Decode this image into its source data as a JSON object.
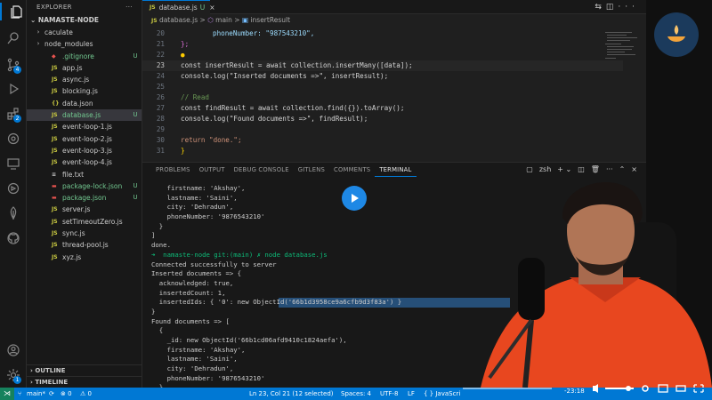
{
  "sidebar": {
    "title": "EXPLORER",
    "folder": "NAMASTE-NODE",
    "items": [
      {
        "label": "caculate",
        "type": "folder",
        "status": "",
        "icon": "chevron-right"
      },
      {
        "label": "node_modules",
        "type": "folder",
        "status": "",
        "icon": "chevron-right"
      },
      {
        "label": ".gitignore",
        "type": "git",
        "status": "U",
        "icon": "git-icon"
      },
      {
        "label": "app.js",
        "type": "js",
        "status": "",
        "icon": "JS"
      },
      {
        "label": "async.js",
        "type": "js",
        "status": "",
        "icon": "JS"
      },
      {
        "label": "blocking.js",
        "type": "js",
        "status": "",
        "icon": "JS"
      },
      {
        "label": "data.json",
        "type": "json",
        "status": "",
        "icon": "{}"
      },
      {
        "label": "database.js",
        "type": "js",
        "status": "U",
        "icon": "JS",
        "selected": true
      },
      {
        "label": "event-loop-1.js",
        "type": "js",
        "status": "",
        "icon": "JS"
      },
      {
        "label": "event-loop-2.js",
        "type": "js",
        "status": "",
        "icon": "JS"
      },
      {
        "label": "event-loop-3.js",
        "type": "js",
        "status": "",
        "icon": "JS"
      },
      {
        "label": "event-loop-4.js",
        "type": "js",
        "status": "",
        "icon": "JS"
      },
      {
        "label": "file.txt",
        "type": "txt",
        "status": "",
        "icon": "≡"
      },
      {
        "label": "package-lock.json",
        "type": "npm",
        "status": "U",
        "icon": "npm"
      },
      {
        "label": "package.json",
        "type": "npm",
        "status": "U",
        "icon": "npm"
      },
      {
        "label": "server.js",
        "type": "js",
        "status": "",
        "icon": "JS"
      },
      {
        "label": "setTimeoutZero.js",
        "type": "js",
        "status": "",
        "icon": "JS"
      },
      {
        "label": "sync.js",
        "type": "js",
        "status": "",
        "icon": "JS"
      },
      {
        "label": "thread-pool.js",
        "type": "js",
        "status": "",
        "icon": "JS"
      },
      {
        "label": "xyz.js",
        "type": "js",
        "status": "",
        "icon": "JS"
      }
    ],
    "outline": "OUTLINE",
    "timeline": "TIMELINE"
  },
  "tab": {
    "icon": "JS",
    "label": "database.js",
    "status": "U"
  },
  "breadcrumb": {
    "icon": "JS",
    "file": "database.js",
    "sep": ">",
    "fn": "main",
    "var": "insertResult"
  },
  "code": [
    {
      "n": "20",
      "text": "phoneNumber: \"987543210\","
    },
    {
      "n": "21",
      "text": "};"
    },
    {
      "n": "22",
      "text": ""
    },
    {
      "n": "23",
      "text": "const insertResult = await collection.insertMany([data]);"
    },
    {
      "n": "24",
      "text": "console.log(\"Inserted documents =>\", insertResult);"
    },
    {
      "n": "25",
      "text": ""
    },
    {
      "n": "26",
      "text": "// Read"
    },
    {
      "n": "27",
      "text": "const findResult = await collection.find({}).toArray();"
    },
    {
      "n": "28",
      "text": "console.log(\"Found documents =>\", findResult);"
    },
    {
      "n": "29",
      "text": ""
    },
    {
      "n": "30",
      "text": "return \"done.\";"
    },
    {
      "n": "31",
      "text": "}"
    }
  ],
  "panel": {
    "tabs": [
      "PROBLEMS",
      "OUTPUT",
      "DEBUG CONSOLE",
      "GITLENS",
      "COMMENTS",
      "TERMINAL"
    ],
    "active_tab": "TERMINAL",
    "shell": "zsh"
  },
  "terminal": [
    "    firstname: 'Akshay',",
    "    lastname: 'Saini',",
    "    city: 'Dehradun',",
    "    phoneNumber: '9876543210'",
    "  }",
    "]",
    "done.",
    "➜  namaste-node git:(main) ✗ node database.js",
    "Connected successfully to server",
    "Inserted documents => {",
    "  acknowledged: true,",
    "  insertedCount: 1,",
    "  insertedIds: { '0': new ObjectId('66b1d3958ce9a6cfb9d3f83a') }",
    "}",
    "Found documents => [",
    "  {",
    "    _id: new ObjectId('66b1cd06afd9410c1824aefa'),",
    "    firstname: 'Akshay',",
    "    lastname: 'Saini',",
    "    city: 'Dehradun',",
    "    phoneNumber: '9876543210'",
    "  },",
    "  {"
  ],
  "status": {
    "branch": "main*",
    "errors": "⊗ 0",
    "warnings": "⚠ 0",
    "position": "Ln 23, Col 21 (12 selected)",
    "spaces": "Spaces: 4",
    "encoding": "UTF-8",
    "eol": "LF",
    "language": "{ } JavaScri",
    "time": "-23:18"
  },
  "colors": {
    "accent": "#0078d4",
    "status_bar": "#0078d4",
    "untracked": "#73c991",
    "js_icon": "#cbcb41"
  }
}
